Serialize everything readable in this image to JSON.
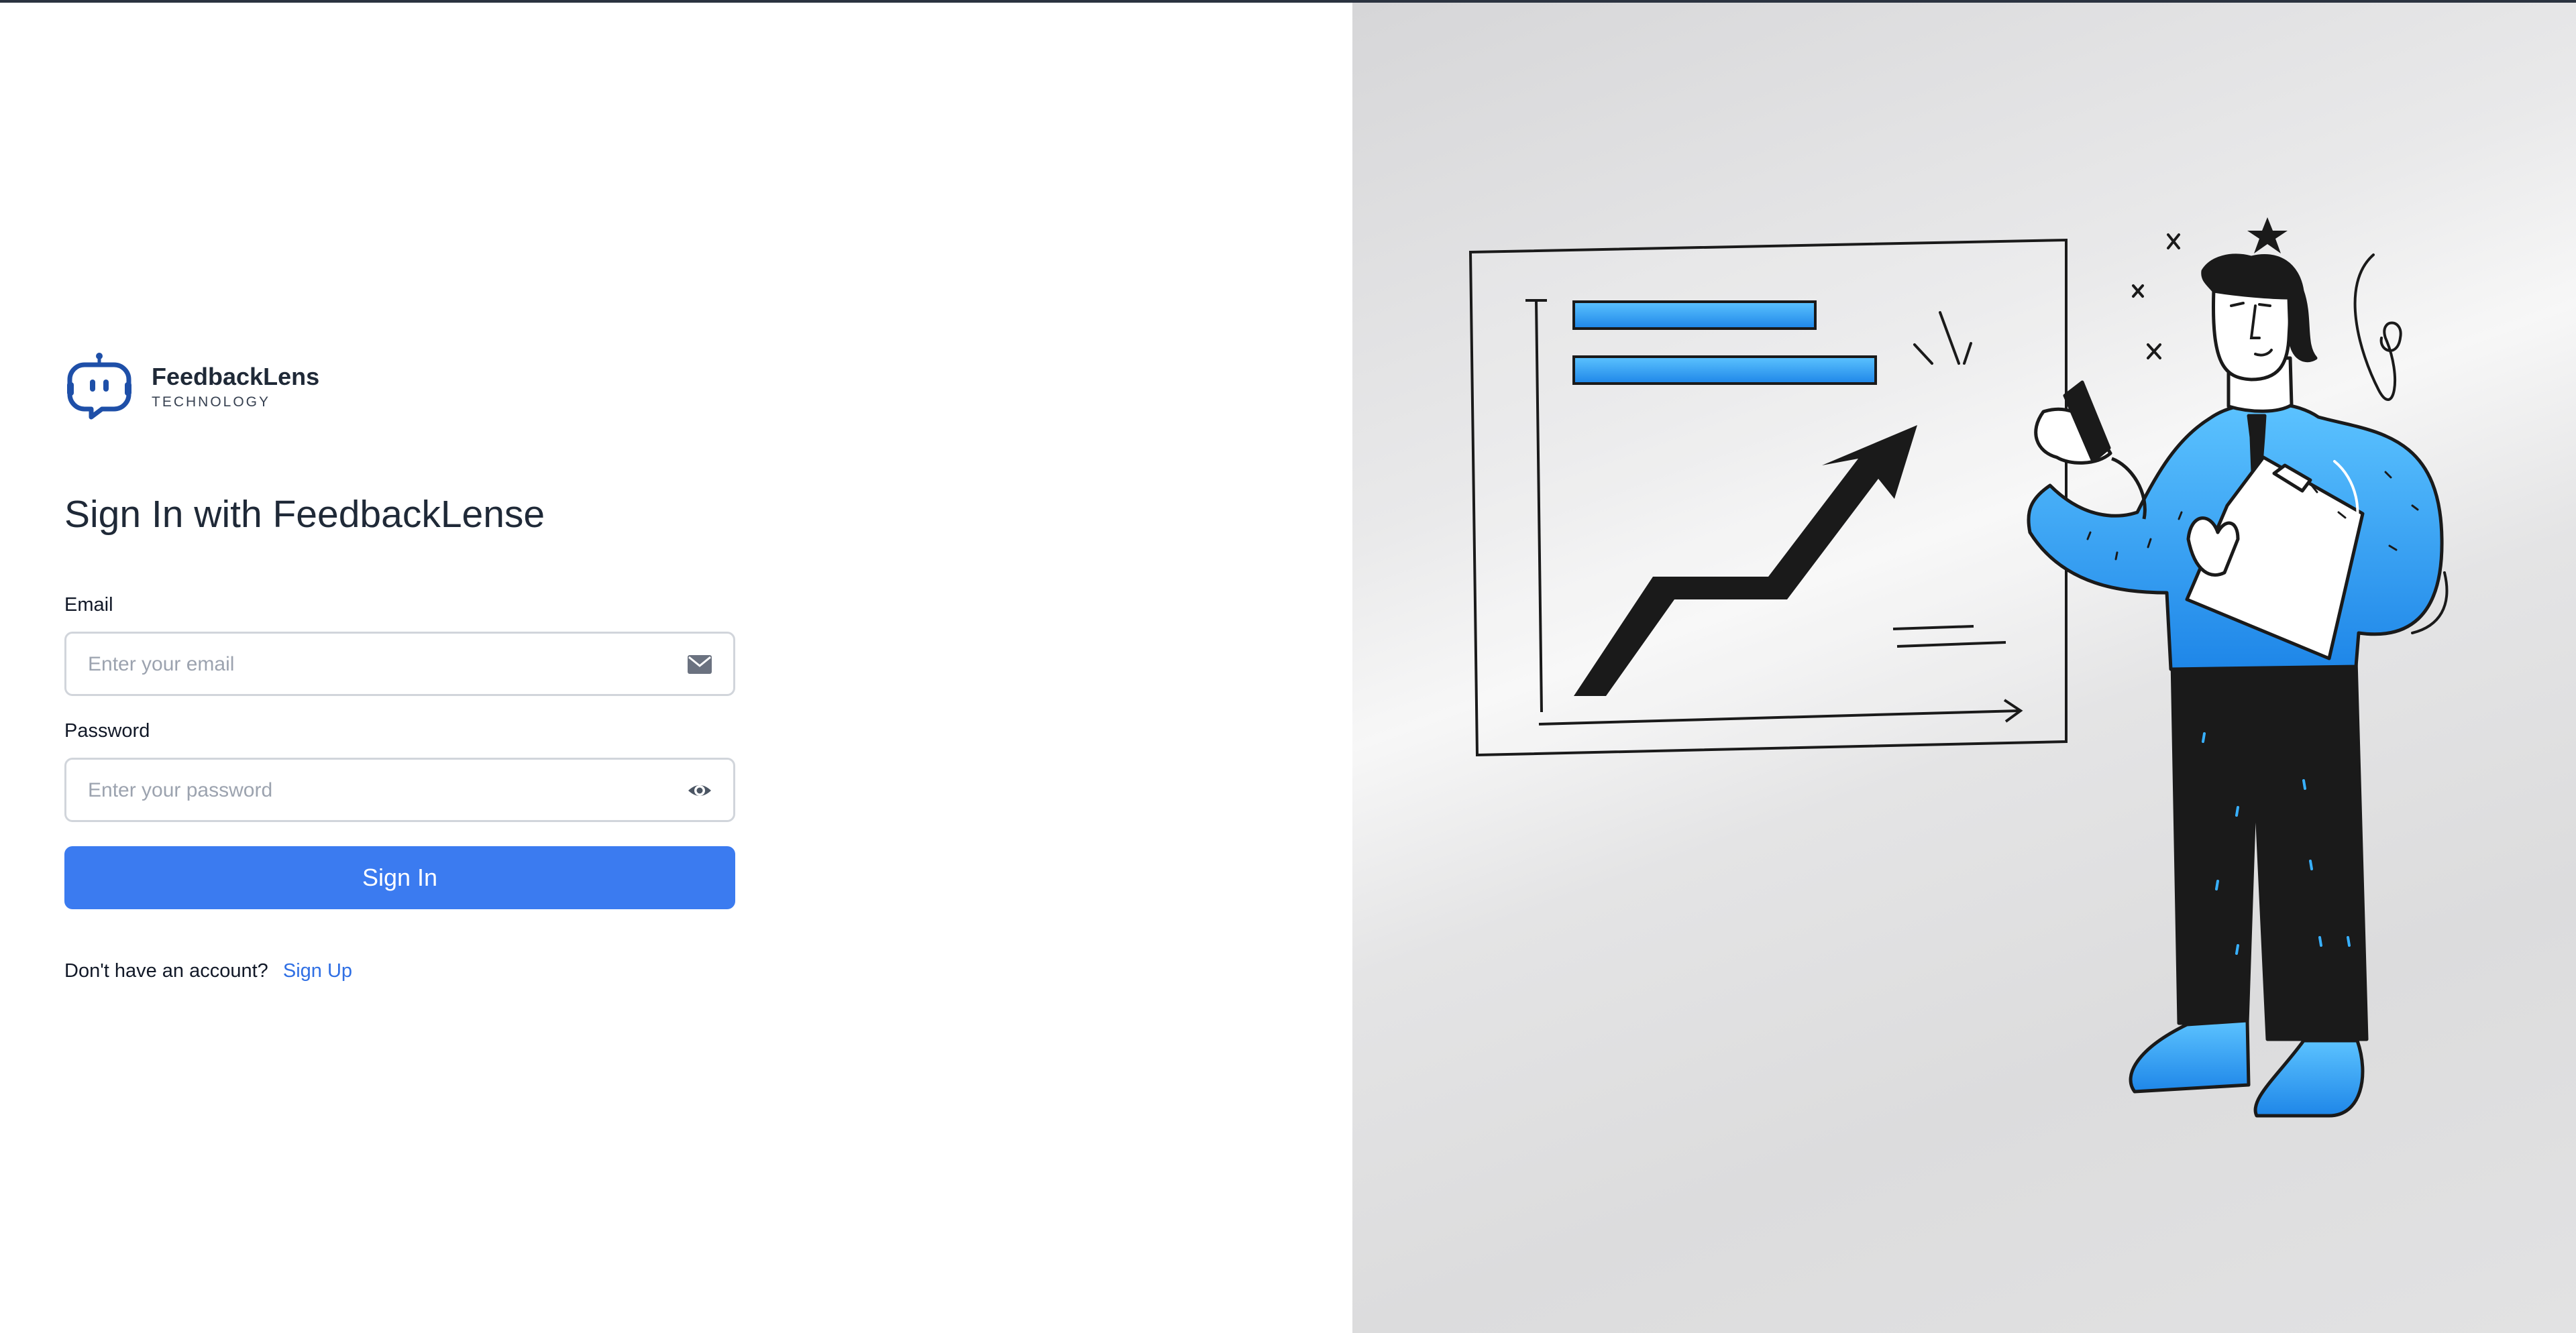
{
  "brand": {
    "name": "FeedbackLens",
    "subtitle": "TECHNOLOGY",
    "logo_icon": "robot-chat-icon",
    "color": "#1e4fa8"
  },
  "form": {
    "title": "Sign In with FeedbackLense",
    "email": {
      "label": "Email",
      "placeholder": "Enter your email",
      "icon": "envelope-icon"
    },
    "password": {
      "label": "Password",
      "placeholder": "Enter your password",
      "icon": "eye-icon"
    },
    "submit_label": "Sign In"
  },
  "signup": {
    "prompt": "Don't have an account?",
    "link_label": "Sign Up"
  },
  "colors": {
    "accent": "#3b7bf0",
    "link": "#2f6fe4",
    "illustration_blue": "#2f9cf0"
  },
  "illustration": {
    "name": "presenter-with-growth-chart"
  }
}
